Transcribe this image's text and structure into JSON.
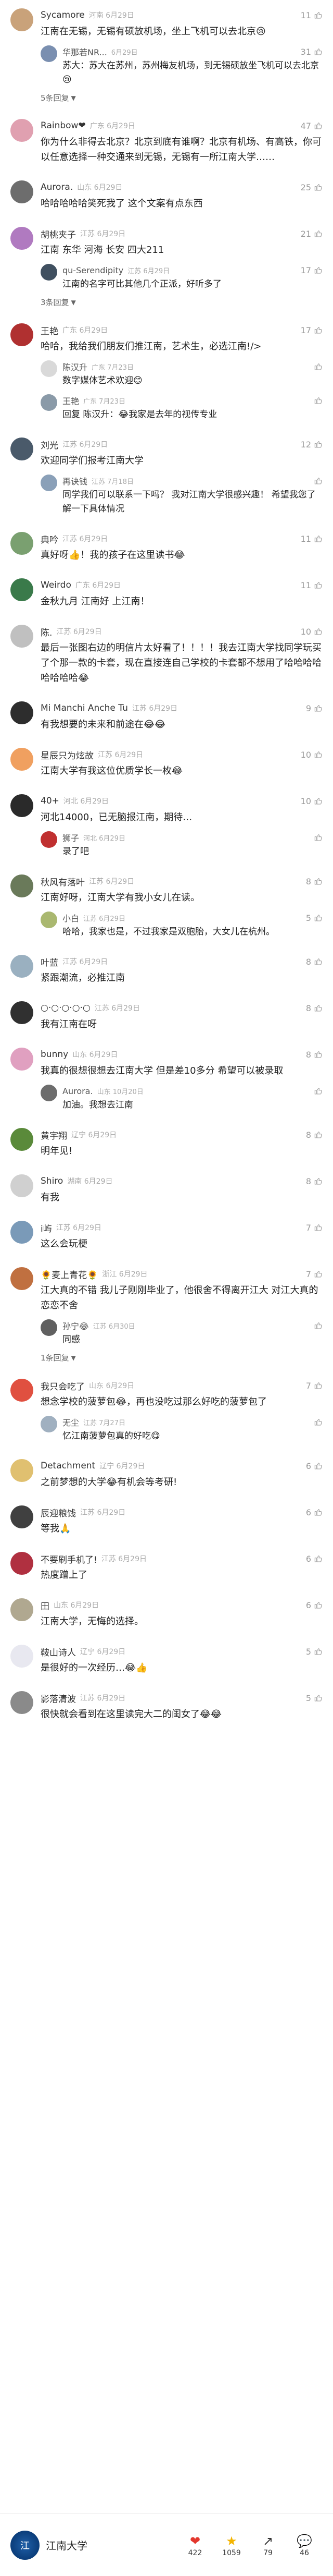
{
  "comments": [
    {
      "avatar_color": "#c9a27a",
      "user": "Sycamore",
      "meta": "河南 6月29日",
      "likes": "11",
      "text": "江南在无锡，无锡有硕放机场，坐上飞机可以去北京😢",
      "replies": [
        {
          "avatar_color": "#7a8fb0",
          "user": "华那若NR...",
          "meta": "6月29日",
          "likes": "31",
          "text": "苏大：苏大在苏州，苏州梅友机场，到无锡硕放坐飞机可以去北京😢"
        }
      ],
      "more": "5条回复"
    },
    {
      "avatar_color": "#e0a0b0",
      "user": "Rainbow❤",
      "meta": "广东 6月29日",
      "likes": "47",
      "text": "你为什么非得去北京？北京到底有谁啊？北京有机场、有高铁，你可以任意选择一种交通来到无锡，无锡有一所江南大学……",
      "replies": [],
      "more": ""
    },
    {
      "avatar_color": "#6d6d6d",
      "user": "Aurora.",
      "meta": "山东 6月29日",
      "likes": "25",
      "text": "哈哈哈哈哈笑死我了 这个文案有点东西",
      "replies": [],
      "more": ""
    },
    {
      "avatar_color": "#b07ac0",
      "user": "胡桃夹子",
      "meta": "江苏 6月29日",
      "likes": "21",
      "text": "江南 东华 河海 长安 四大211",
      "replies": [
        {
          "avatar_color": "#405060",
          "user": "qu-Serendipity",
          "meta": "江苏 6月29日",
          "likes": "17",
          "text": "江南的名字可比其他几个正派，好听多了"
        }
      ],
      "more": "3条回复"
    },
    {
      "avatar_color": "#b03030",
      "user": "王艳",
      "meta": "广东 6月29日",
      "likes": "17",
      "text": "哈哈，我给我们朋友们推江南，艺术生，必选江南!/>",
      "replies": [
        {
          "avatar_color": "#d9d9d9",
          "user": "陈汉升",
          "meta": "广东 7月23日",
          "likes": "",
          "text": "数字媒体艺术欢迎😊"
        },
        {
          "avatar_color": "#8a9aa8",
          "user": "王艳",
          "meta": "广东 7月23日",
          "likes": "",
          "text": "回复 陈汉升：😂我家是去年的视传专业"
        }
      ],
      "more": ""
    },
    {
      "avatar_color": "#4a5a6a",
      "user": "刘光",
      "meta": "江苏 6月29日",
      "likes": "12",
      "text": "欢迎同学们报考江南大学",
      "replies": [
        {
          "avatar_color": "#8aa0b8",
          "user": "再诀钱",
          "meta": "江苏 7月18日",
          "likes": "",
          "text": "同学我们可以联系一下吗？ 我对江南大学很感兴趣！ 希望我您了解一下具体情况"
        }
      ],
      "more": ""
    },
    {
      "avatar_color": "#7aa070",
      "user": "典吟",
      "meta": "江苏 6月29日",
      "likes": "11",
      "text": "真好呀👍！我的孩子在这里读书😂",
      "replies": [],
      "more": ""
    },
    {
      "avatar_color": "#3a7a4a",
      "user": "Weirdo",
      "meta": "广东 6月29日",
      "likes": "11",
      "text": "金秋九月 江南好 上江南！",
      "replies": [],
      "more": ""
    },
    {
      "avatar_color": "#c0c0c0",
      "user": "陈.",
      "meta": "江苏 6月29日",
      "likes": "10",
      "text": "最后一张图右边的明信片太好看了！！！！我去江南大学找同学玩买了个那一款的卡套，现在直接连自己学校的卡套都不想用了哈哈哈哈哈哈哈哈😂",
      "replies": [],
      "more": ""
    },
    {
      "avatar_color": "#2d2d2d",
      "user": "Mi Manchi Anche Tu",
      "meta": "江苏 6月29日",
      "likes": "9",
      "text": "有我想要的未来和前途在😂😂",
      "replies": [],
      "more": ""
    },
    {
      "avatar_color": "#f0a060",
      "user": "星辰只为炫故",
      "meta": "江苏 6月29日",
      "likes": "10",
      "text": "江南大学有我这位优质学长一枚😂",
      "replies": [],
      "more": ""
    },
    {
      "avatar_color": "#2a2a2a",
      "user": "40+",
      "meta": "河北 6月29日",
      "likes": "10",
      "text": "河北14000，已无脑报江南，期待…",
      "replies": [
        {
          "avatar_color": "#c03030",
          "user": "狮子",
          "meta": "河北 6月29日",
          "likes": "",
          "text": "录了吧"
        }
      ],
      "more": ""
    },
    {
      "avatar_color": "#6a7a5a",
      "user": "秋风有落叶",
      "meta": "江苏 6月29日",
      "likes": "8",
      "text": "江南好呀，江南大学有我小女儿在读。",
      "replies": [
        {
          "avatar_color": "#aab870",
          "user": "小白",
          "meta": "江苏 6月29日",
          "likes": "5",
          "text": "哈哈，我家也是，不过我家是双胞胎，大女儿在杭州。"
        }
      ],
      "more": ""
    },
    {
      "avatar_color": "#9ab0c0",
      "user": "叶蓝",
      "meta": "江苏 6月29日",
      "likes": "8",
      "text": "紧跟潮流，必推江南",
      "replies": [],
      "more": ""
    },
    {
      "avatar_color": "#303030",
      "user": "○·○·○·○·○",
      "meta": "江苏 6月29日",
      "likes": "8",
      "text": "我有江南在呀",
      "replies": [],
      "more": ""
    },
    {
      "avatar_color": "#e0a0c0",
      "user": "bunny",
      "meta": "山东 6月29日",
      "likes": "8",
      "text": "我真的很想很想去江南大学 但是差10多分 希望可以被录取",
      "replies": [
        {
          "avatar_color": "#6d6d6d",
          "user": "Aurora.",
          "meta": "山东 10月20日",
          "likes": "",
          "text": "加油。我想去江南"
        }
      ],
      "more": ""
    },
    {
      "avatar_color": "#5a8a3a",
      "user": "黄宇翔",
      "meta": "辽宁 6月29日",
      "likes": "8",
      "text": "明年见!",
      "replies": [],
      "more": ""
    },
    {
      "avatar_color": "#d0d0d0",
      "user": "Shiro",
      "meta": "湖南 6月29日",
      "likes": "8",
      "text": "有我",
      "replies": [],
      "more": ""
    },
    {
      "avatar_color": "#7a9ab8",
      "user": "i屿",
      "meta": "江苏 6月29日",
      "likes": "7",
      "text": "这么会玩梗",
      "replies": [],
      "more": ""
    },
    {
      "avatar_color": "#c07040",
      "user": "🌻麦上青花🌻",
      "meta": "浙江 6月29日",
      "likes": "7",
      "text": "江大真的不错 我儿子刚刚毕业了，他很舍不得离开江大 对江大真的恋恋不舍",
      "replies": [
        {
          "avatar_color": "#606060",
          "user": "孙宁😂",
          "meta": "江苏 6月30日",
          "likes": "",
          "text": "同感"
        }
      ],
      "more": "1条回复"
    },
    {
      "avatar_color": "#e05040",
      "user": "我只会吃了",
      "meta": "山东 6月29日",
      "likes": "7",
      "text": "想念学校的菠萝包😂，再也没吃过那么好吃的菠萝包了",
      "replies": [
        {
          "avatar_color": "#a0b0c0",
          "user": "无尘",
          "meta": "江苏 7月27日",
          "likes": "",
          "text": "忆江南菠萝包真的好吃😋"
        }
      ],
      "more": ""
    },
    {
      "avatar_color": "#e0c070",
      "user": "Detachment",
      "meta": "辽宁 6月29日",
      "likes": "6",
      "text": "之前梦想的大学😂有机会等考研!",
      "replies": [],
      "more": ""
    },
    {
      "avatar_color": "#404040",
      "user": "辰迎粮饯",
      "meta": "江苏 6月29日",
      "likes": "6",
      "text": "等我🙏",
      "replies": [],
      "more": ""
    },
    {
      "avatar_color": "#b03040",
      "user": "不要刷手机了!",
      "meta": "江苏 6月29日",
      "likes": "6",
      "text": "热度蹭上了",
      "replies": [],
      "more": ""
    },
    {
      "avatar_color": "#b0a890",
      "user": "田",
      "meta": "山东 6月29日",
      "likes": "6",
      "text": "江南大学，无悔的选择。",
      "replies": [],
      "more": ""
    },
    {
      "avatar_color": "#e8e8f0",
      "user": "鞍山诗人",
      "meta": "辽宁 6月29日",
      "likes": "5",
      "text": "是很好的一次经历…😂👍",
      "replies": [],
      "more": ""
    },
    {
      "avatar_color": "#8a8a8a",
      "user": "影落清波",
      "meta": "江苏 6月29日",
      "likes": "5",
      "text": "很快就会看到在这里读完大二的闺女了😂😂",
      "replies": [],
      "more": ""
    }
  ],
  "bottom_bar": {
    "account_name": "江南大学",
    "likes": "422",
    "favorites": "1059",
    "shares": "79",
    "comments": "46"
  }
}
